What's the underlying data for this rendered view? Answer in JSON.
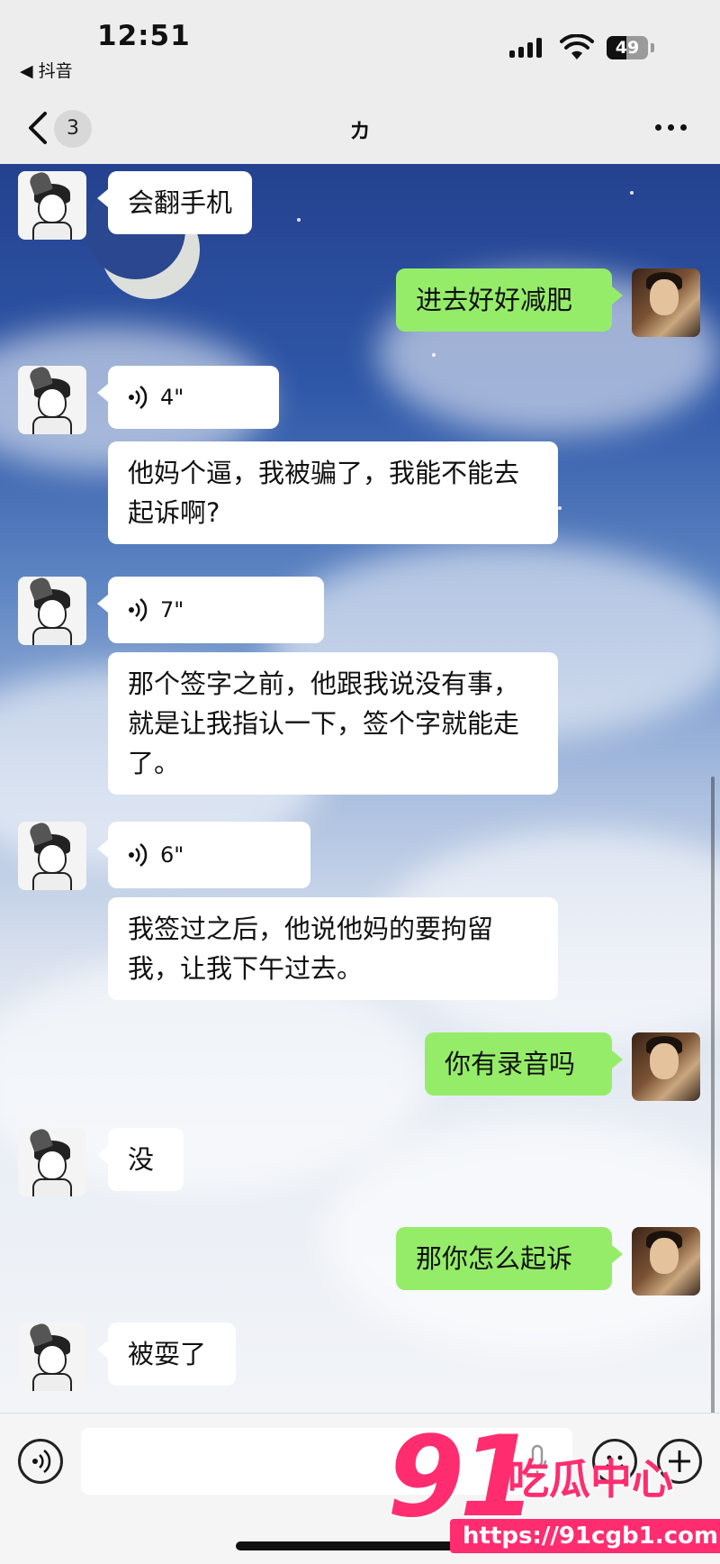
{
  "status_bar": {
    "time": "12:51",
    "back_app": "◀ 抖音",
    "battery": "49"
  },
  "nav": {
    "unread_count": "3",
    "title": "カ"
  },
  "messages": [
    {
      "side": "left",
      "type": "text",
      "text": "会翻手机"
    },
    {
      "side": "right",
      "type": "text",
      "text": "进去好好减肥"
    },
    {
      "side": "left",
      "type": "voice",
      "duration": "4\""
    },
    {
      "side": "left",
      "type": "text",
      "text": "他妈个逼，我被骗了，我能不能去起诉啊?"
    },
    {
      "side": "left",
      "type": "voice",
      "duration": "7\""
    },
    {
      "side": "left",
      "type": "text",
      "text": "那个签字之前，他跟我说没有事，就是让我指认一下，签个字就能走了。"
    },
    {
      "side": "left",
      "type": "voice",
      "duration": "6\""
    },
    {
      "side": "left",
      "type": "text",
      "text": "我签过之后，他说他妈的要拘留我，让我下午过去。"
    },
    {
      "side": "right",
      "type": "text",
      "text": "你有录音吗"
    },
    {
      "side": "left",
      "type": "text",
      "text": "没"
    },
    {
      "side": "right",
      "type": "text",
      "text": "那你怎么起诉"
    },
    {
      "side": "left",
      "type": "text",
      "text": "被耍了"
    }
  ],
  "input_bar": {
    "placeholder": ""
  },
  "watermark": {
    "number": "91",
    "text": "吃瓜中心",
    "url": "https://91cgb1.com"
  },
  "colors": {
    "bubble_self": "#95ec69",
    "bubble_other": "#ffffff",
    "watermark": "#ff2d6f"
  }
}
